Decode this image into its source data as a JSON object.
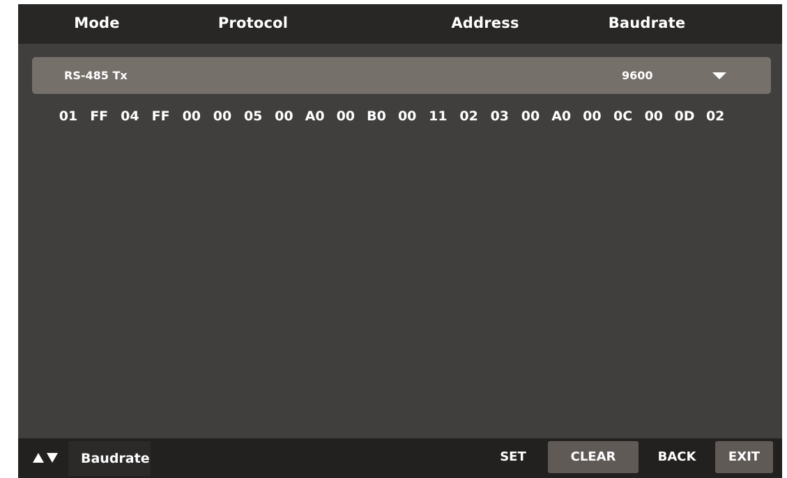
{
  "header": {
    "columns": [
      "Mode",
      "Protocol",
      "Address",
      "Baudrate"
    ]
  },
  "selection": {
    "mode": "RS-485 Tx",
    "baudrate": "9600"
  },
  "data_bytes": [
    "01",
    "FF",
    "04",
    "FF",
    "00",
    "00",
    "05",
    "00",
    "A0",
    "00",
    "B0",
    "00",
    "11",
    "02",
    "03",
    "00",
    "A0",
    "00",
    "0C",
    "00",
    "0D",
    "02"
  ],
  "footer": {
    "current_field": "Baudrate",
    "buttons": {
      "set": "SET",
      "clear": "CLEAR",
      "back": "BACK",
      "exit": "EXIT"
    }
  },
  "colors": {
    "header_bg": "#282726",
    "screen_bg": "#403f3d",
    "selection_bg": "#76706b",
    "footer_bg": "#222120",
    "active_button_bg": "#605a57",
    "text": "#ffffff"
  },
  "icons": {
    "dropdown": "triangle-down-icon",
    "nav_up": "triangle-up-icon",
    "nav_down": "triangle-down-icon"
  }
}
